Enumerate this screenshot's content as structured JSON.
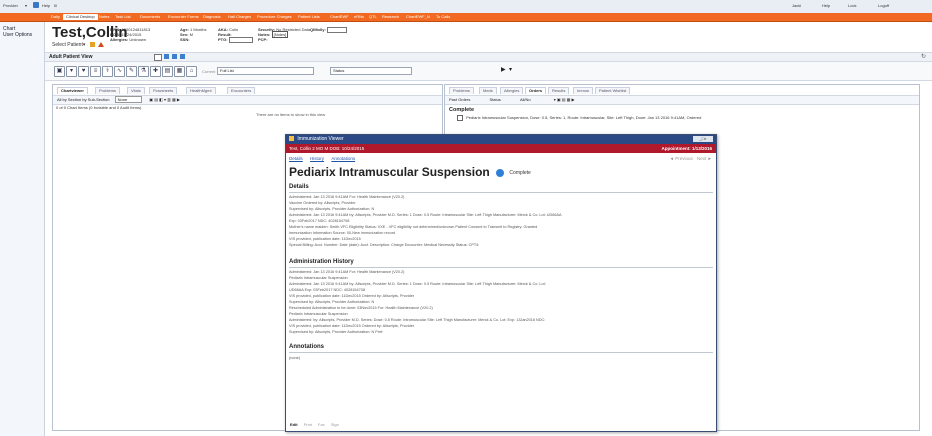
{
  "topbar": {
    "left_items": [
      "Provider",
      "▾",
      "Help",
      "Ill"
    ],
    "right_items": [
      "Jacki",
      "Help",
      "Lock",
      "Logoff"
    ]
  },
  "tabs": [
    {
      "label": "Daily"
    },
    {
      "label": "Clinical Desktop"
    },
    {
      "label": "Notes"
    },
    {
      "label": "Task List"
    },
    {
      "label": "Documents"
    },
    {
      "label": "Encounter Forms"
    },
    {
      "label": "Diagnosis"
    },
    {
      "label": "Hall Charges"
    },
    {
      "label": "Procedure Charges"
    },
    {
      "label": "Patient Lists"
    },
    {
      "label": "ChartEWF"
    },
    {
      "label": "eRNs"
    },
    {
      "label": "QTL"
    },
    {
      "label": "Research"
    },
    {
      "label": "ChartEWF_N"
    },
    {
      "label": "To Calls"
    }
  ],
  "leftnav": {
    "title": "Chart",
    "items": [
      "Chart",
      "User Options"
    ]
  },
  "patient": {
    "name": "Test,Collin",
    "select_label": "Select Patient▾",
    "mrn_label": "MRN:",
    "mrn_value": "1000124811813",
    "dob_label": "DOB:",
    "dob_value": "10/24/2015",
    "allergies_label": "Allergies:",
    "allergies_value": "Unknown",
    "age_label": "Age:",
    "age_value": "1 Months",
    "sex_label": "Sex:",
    "sex_value": "M",
    "ssn_label": "SSN:",
    "ssn_value": "",
    "aka_label": "AKA:",
    "aka_value": "Colin",
    "result_label": "Result:",
    "ptg_label": "PTG:",
    "security_label": "Security:",
    "security_value": "No Restricted Data",
    "notes_label": "Notes:",
    "notes_value": "[Notes]",
    "pcp_label": "PCP:",
    "qualify_label": "QIMolly:"
  },
  "viewbar": {
    "view_label": "Adult Patient View"
  },
  "toolbar": {
    "combo1": "Full List",
    "combo2": "Status"
  },
  "leftpane": {
    "tabs": [
      "Chartviewer",
      "Problems",
      "Vitals",
      "Flowsheets",
      "HealthMgmt",
      "Encounters"
    ],
    "filter_label": "All by Section by Sub-Section",
    "filter_value": "None",
    "count_text": "0 of 0 Chart Items (0 Invisible and 0 Audit Items)",
    "empty_text": "There are no items to show in this view"
  },
  "rightpane": {
    "tabs": [
      "Problems",
      "Meds",
      "Allergies",
      "Orders",
      "Results",
      "Immun",
      "Patient Wishlist"
    ],
    "filter1": "Past Orders",
    "filter2": "Status",
    "filter3": "All/No",
    "group_label": "Complete",
    "order_text": "Pediarix Intramuscular Suspension, Dose: 0.5, Series: 1, Route: Intramuscular, Site: Left Thigh, Done: Jan 13 2016 9:41AM, Ordered"
  },
  "modal": {
    "title": "Immunization Viewer",
    "patient_bar_left": "Test, Collin  2 MO  M DOB: 10/24/2015",
    "patient_bar_right": "Appointment: 1/13/2016",
    "links": [
      "Details",
      "History",
      "Annotations"
    ],
    "nav_prev": "Previous",
    "nav_next": "Next",
    "heading": "Pediarix Intramuscular Suspension",
    "status": "Complete",
    "details_title": "Details",
    "details_lines": [
      "Administered: Jan 13 2016 9:41AM    For: Health Maintenance (V20.2)",
      "Vaccine Ordered by: Allscripts, Provider",
      "Supervised by: Allscripts, Provider    Authorization: N",
      "Administered: Jan 13 2016 9:41AM    by: Allscripts, Provider M.D.    Series: 1    Dose: 0.5    Route: Intramuscular    Site: Left Thigh    Manufacturer: Merck & Co.    Lot: UD66AA",
      "Exp: 03Feb2017    NDC: 4028154708",
      "Mother's name maiden: Smith    VFC Eligibility Status: VXE - VFC eligibility not determined/unknown    Patient Consent to Transmit to Registry: Granted",
      "Immunization Information Source: 00-New immunization record",
      "VIS provided, publication date: 11Dec2015",
      "Special Billing:    Acct. Number:    Date (date):    Acct. Description:    Charge Encounter:    Medical Necessity Status:    CPT4:"
    ],
    "history_title": "Administration History",
    "history_lines": [
      "Administered: Jan 13 2016 9:41AM    For: Health Maintenance (V20.2)",
      "    Pediarix Intramuscular Suspension",
      "    Administered: Jan 13 2016 9:41AM    by: Allscripts, Provider M.D.    Series: 1    Dose: 0.5    Route: Intramuscular    Site: Left Thigh    Manufacturer: Merck & Co.    Lot:",
      "    UD66AA    Exp: 03Feb2017    NDC: 4028154708",
      "    VIS provided, publication date: 11Dec2015    Ordered by: Allscripts, Provider",
      "    Supervised by: Allscripts, Provider    Authorization: N",
      "Rescheduled Administration to be done: 03Nov2015    For: Health Maintenance (V20.2)",
      "    Pediarix Intramuscular Suspension",
      "    Administered:    by: Allscripts, Provider M.D.    Series:    Dose: 0.5    Route: Intramuscular    Site: Left Thigh    Manufacturer: Merck & Co.    Lot:    Exp: 13Jan2016    NDC:",
      "    VIS provided, publication date: 11Dec2015    Ordered by: Allscripts, Provider",
      "    Supervised by: Allscripts, Provider    Authorization: N    Pref:"
    ],
    "annotations_title": "Annotations",
    "annotations_empty": "(none)",
    "footer_actions": [
      "Edit",
      "Print",
      "Fax",
      "Sign"
    ]
  },
  "colors": {
    "tabstrip": "#f26a21",
    "modal_title": "#2b4a85",
    "patient_bar": "#b0182c",
    "status_icon": "#2f7fd8"
  }
}
